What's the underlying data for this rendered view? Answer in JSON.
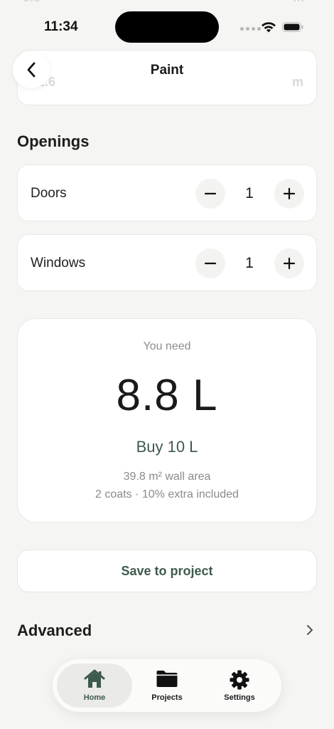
{
  "status_bar": {
    "time": "11:34"
  },
  "header": {
    "title": "Paint"
  },
  "openings": {
    "title": "Openings",
    "rows": [
      {
        "label": "Doors",
        "value": "1"
      },
      {
        "label": "Windows",
        "value": "1"
      }
    ]
  },
  "result": {
    "caption": "You need",
    "amount": "8.8 L",
    "buy": "Buy 10 L",
    "wall_area": "39.8 m² wall area",
    "details": "2 coats · 10% extra included"
  },
  "save_button": {
    "label": "Save to project"
  },
  "advanced": {
    "label": "Advanced"
  },
  "tab_bar": {
    "tabs": [
      {
        "label": "Home",
        "icon": "house-icon",
        "active": true
      },
      {
        "label": "Projects",
        "icon": "folder-icon",
        "active": false
      },
      {
        "label": "Settings",
        "icon": "gear-icon",
        "active": false
      }
    ]
  },
  "colors": {
    "background": "#f5f5f3",
    "accent_green": "#3e5a4d",
    "card": "#ffffff"
  }
}
